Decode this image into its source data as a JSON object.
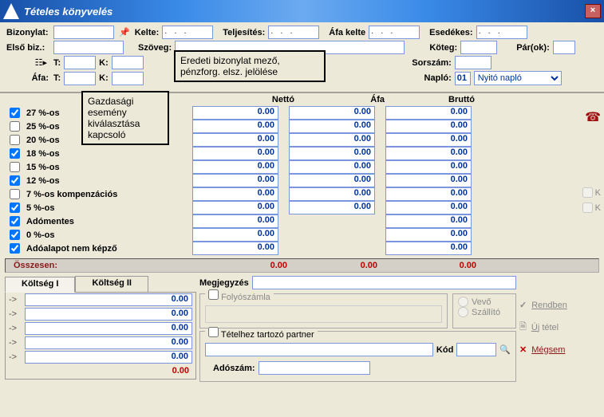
{
  "window": {
    "title": "Tételes könyvelés"
  },
  "labels": {
    "bizonylat": "Bizonylat:",
    "kelte": "Kelte:",
    "teljesites": "Teljesítés:",
    "afa_kelte": "Áfa kelte",
    "esedekes": "Esedékes:",
    "elso_biz": "Első biz.:",
    "szoveg": "Szöveg:",
    "koteg": "Köteg:",
    "parok": "Pár(ok):",
    "T": "T:",
    "K": "K:",
    "afa": "Áfa:",
    "sorszam": "Sorszám:",
    "naplo": "Napló:",
    "netto": "Nettó",
    "afa_col": "Áfa",
    "brutto": "Bruttó",
    "osszesen": "Összesen:",
    "koltseg1": "Költség I",
    "koltseg2": "Költség II",
    "megjegyzes": "Megjegyzés",
    "folyoszamla": "Folyószámla",
    "vevo": "Vevő",
    "szallito": "Szállító",
    "tetelhez_partner": "Tételhez tartozó partner",
    "kod": "Kód",
    "adoszam": "Adószám:",
    "rendben": "Rendben",
    "uj_tetel": "Új tétel",
    "megsem": "Mégsem"
  },
  "header": {
    "bizonylat": "",
    "kelte": ". . .",
    "teljesites": ". . .",
    "afa_kelte": ". . .",
    "esedekes": ". . .",
    "elso_biz": "",
    "szoveg": "",
    "koteg": "",
    "parok": "",
    "T1": "",
    "K1": "",
    "afa_T": "",
    "afa_K": "",
    "sorszam": "",
    "naplo_code": "01",
    "naplo_name": "Nyitó napló"
  },
  "callouts": {
    "top": "Eredeti bizonylat mező,\npénzforg. elsz. jelölése",
    "left": "Gazdasági\nesemény\nkiválasztása\nkapcsoló"
  },
  "tax_rows": [
    {
      "label": "27 %-os",
      "checked": true,
      "netto": "0.00",
      "afa": "0.00",
      "brutto": "0.00"
    },
    {
      "label": "25 %-os",
      "checked": false,
      "netto": "0.00",
      "afa": "0.00",
      "brutto": "0.00"
    },
    {
      "label": "20 %-os",
      "checked": false,
      "netto": "0.00",
      "afa": "0.00",
      "brutto": "0.00"
    },
    {
      "label": "18 %-os",
      "checked": true,
      "netto": "0.00",
      "afa": "0.00",
      "brutto": "0.00"
    },
    {
      "label": "15 %-os",
      "checked": false,
      "netto": "0.00",
      "afa": "0.00",
      "brutto": "0.00"
    },
    {
      "label": "12 %-os",
      "checked": true,
      "netto": "0.00",
      "afa": "0.00",
      "brutto": "0.00"
    },
    {
      "label": "7 %-os kompenzációs",
      "checked": false,
      "netto": "0.00",
      "afa": "0.00",
      "brutto": "0.00"
    },
    {
      "label": "5 %-os",
      "checked": true,
      "netto": "0.00",
      "afa": "0.00",
      "brutto": "0.00"
    },
    {
      "label": "Adómentes",
      "checked": true,
      "netto": "0.00",
      "afa": "",
      "brutto": "0.00"
    },
    {
      "label": "0 %-os",
      "checked": true,
      "netto": "0.00",
      "afa": "",
      "brutto": "0.00"
    },
    {
      "label": "Adóalapot nem képző",
      "checked": true,
      "netto": "0.00",
      "afa": "",
      "brutto": "0.00"
    }
  ],
  "totals": {
    "netto": "0.00",
    "afa": "0.00",
    "brutto": "0.00"
  },
  "koltseg": {
    "rows": [
      "0.00",
      "0.00",
      "0.00",
      "0.00",
      "0.00"
    ],
    "sum": "0.00"
  },
  "comment": "",
  "partner": {
    "folyoszamla": false,
    "kod": "",
    "adoszam": ""
  }
}
